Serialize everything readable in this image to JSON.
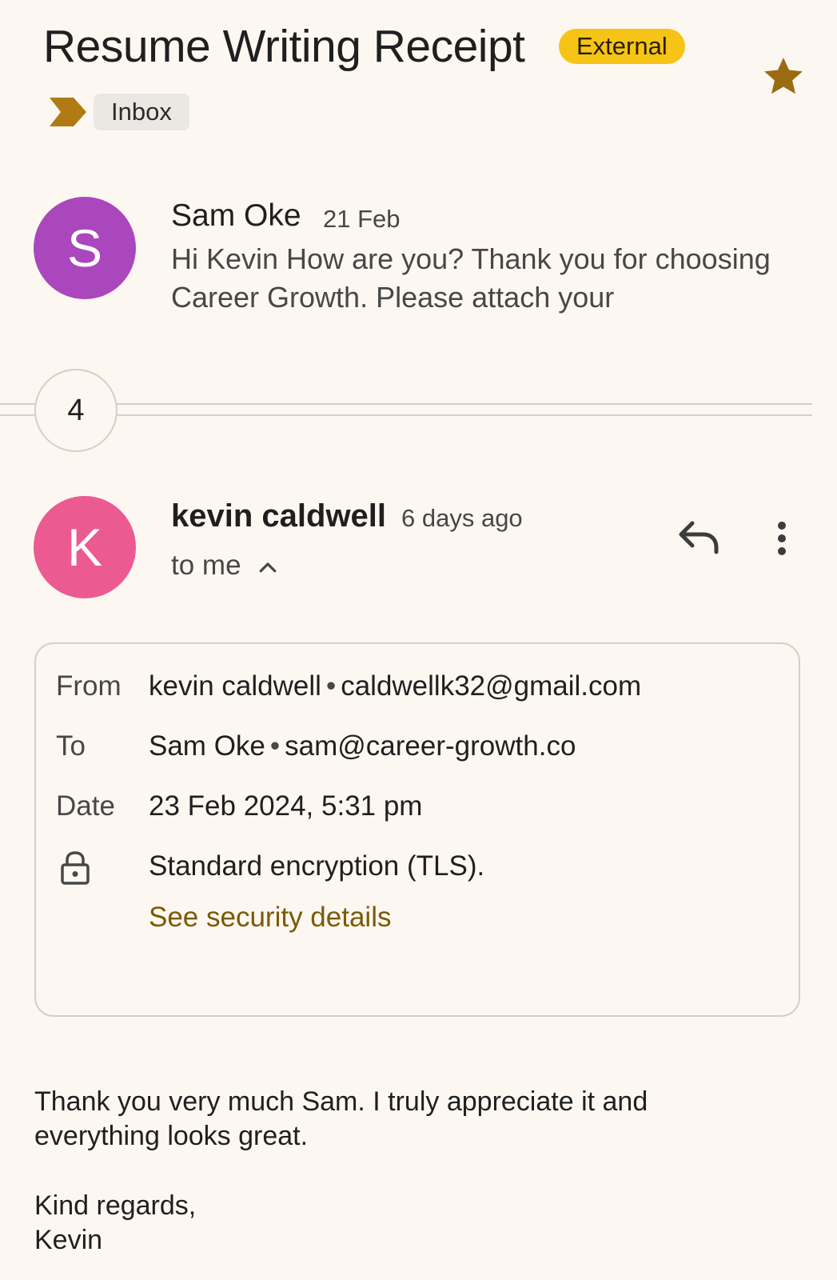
{
  "header": {
    "subject": "Resume Writing Receipt",
    "external_badge": "External",
    "label": "Inbox",
    "starred": true,
    "important_icon": "important-marker-icon",
    "star_icon": "star-icon"
  },
  "thread": {
    "collapsed_message": {
      "avatar_letter": "S",
      "avatar_color": "#ab47bc",
      "sender": "Sam Oke",
      "date": "21 Feb",
      "snippet": "Hi Kevin How are you? Thank you for choosing Career Growth. Please attach your"
    },
    "collapsed_count": "4",
    "expanded_message": {
      "avatar_letter": "K",
      "avatar_color": "#ec5a92",
      "sender": "kevin caldwell",
      "date": "6 days ago",
      "recipient_summary": "to me",
      "details": {
        "from_label": "From",
        "from_name": "kevin caldwell",
        "from_email": "caldwellk32@gmail.com",
        "to_label": "To",
        "to_name": "Sam Oke",
        "to_email": "sam@career-growth.co",
        "date_label": "Date",
        "date_value": "23 Feb 2024, 5:31 pm",
        "encryption": "Standard encryption (TLS).",
        "security_link": "See security details"
      },
      "body": {
        "paragraph1": "Thank you very much Sam. I truly appreciate it and\neverything looks great.",
        "paragraph2": "Kind regards,\nKevin"
      }
    }
  },
  "colors": {
    "background": "#fdf7f2",
    "external_badge": "#f6c417",
    "star": "#9a6b12",
    "link": "#7a5a00"
  }
}
